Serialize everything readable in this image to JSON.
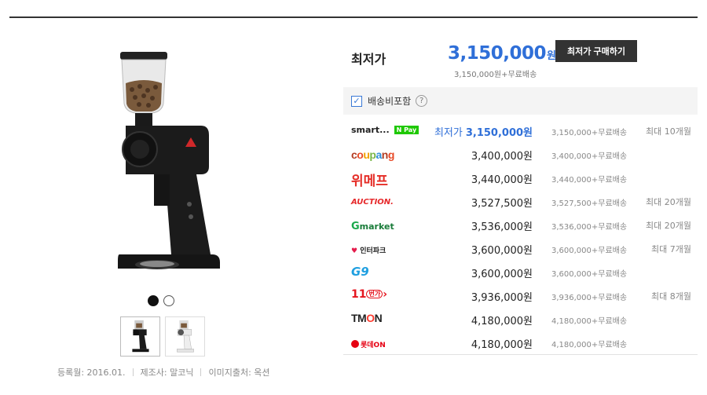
{
  "best": {
    "label": "최저가",
    "price": "3,150,000",
    "won": "원",
    "sub": "3,150,000원+무료배송",
    "buy_label": "최저가 구매하기"
  },
  "shipping": {
    "label": "배송비포함",
    "checked": "✓",
    "help": "?"
  },
  "sellers": [
    {
      "name": "smart...",
      "badge": "N Pay",
      "best_tag": "최저가",
      "price": "3,150,000원",
      "ship": "3,150,000+무료배송",
      "inst": "최대 10개월"
    },
    {
      "name": "coupang",
      "price": "3,400,000원",
      "ship": "3,400,000+무료배송",
      "inst": ""
    },
    {
      "name": "위메프",
      "price": "3,440,000원",
      "ship": "3,440,000+무료배송",
      "inst": ""
    },
    {
      "name": "AUCTION.",
      "price": "3,527,500원",
      "ship": "3,527,500+무료배송",
      "inst": "최대 20개월"
    },
    {
      "name": "market",
      "name_prefix": "G",
      "price": "3,536,000원",
      "ship": "3,536,000+무료배송",
      "inst": "최대 20개월"
    },
    {
      "name": "인터파크",
      "price": "3,600,000원",
      "ship": "3,600,000+무료배송",
      "inst": "최대 7개월"
    },
    {
      "name": "G9",
      "price": "3,600,000원",
      "ship": "3,600,000+무료배송",
      "inst": ""
    },
    {
      "name": "11",
      "name_suffix": "번가",
      "price": "3,936,000원",
      "ship": "3,936,000+무료배송",
      "inst": "최대 8개월"
    },
    {
      "name_a": "TM",
      "name_b": "O",
      "name_c": "N",
      "price": "4,180,000원",
      "ship": "4,180,000+무료배송",
      "inst": ""
    },
    {
      "name": "롯데ON",
      "price": "4,180,000원",
      "ship": "4,180,000+무료배송",
      "inst": ""
    }
  ],
  "meta": {
    "registered": "등록월: 2016.01.",
    "maker": "제조사: 말코닉",
    "image_source": "이미지출처: 옥션"
  },
  "icons": {
    "dot_active": "carousel-dot-active",
    "dot_inactive": "carousel-dot",
    "check": "check-icon",
    "help": "help-icon"
  },
  "colors": {
    "accent": "#2f6fd8",
    "button": "#333333",
    "npay": "#1ec800"
  }
}
